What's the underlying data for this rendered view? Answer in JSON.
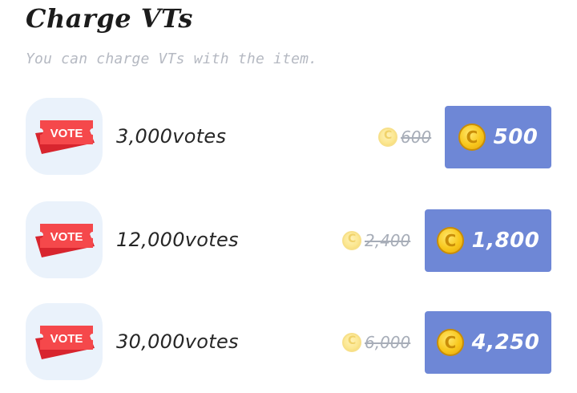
{
  "header": {
    "title": "Charge VTs",
    "subtitle": "You can charge VTs with the item."
  },
  "items": [
    {
      "ticket_text": "VOTE",
      "votes": "3,000votes",
      "original_price": "600",
      "price": "500"
    },
    {
      "ticket_text": "VOTE",
      "votes": "12,000votes",
      "original_price": "2,400",
      "price": "1,800"
    },
    {
      "ticket_text": "VOTE",
      "votes": "30,000votes",
      "original_price": "6,000",
      "price": "4,250"
    }
  ],
  "icons": {
    "ticket": "vote-ticket-icon",
    "coin": "coin-icon"
  },
  "colors": {
    "button": "#6e87d6",
    "ticket_red": "#f04a4a",
    "tile_bg": "#eaf2fb",
    "coin_gold": "#f8c71c"
  }
}
